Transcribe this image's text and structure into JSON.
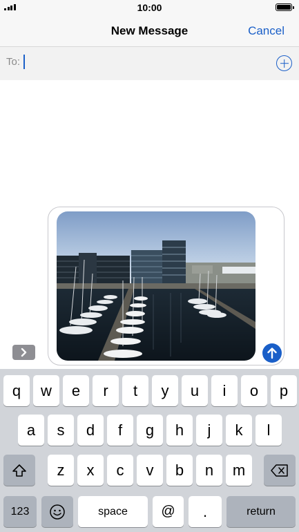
{
  "status_bar": {
    "time": "10:00"
  },
  "nav": {
    "title": "New Message",
    "cancel_label": "Cancel"
  },
  "to_field": {
    "label": "To:"
  },
  "compose": {
    "attachment": "photo of a harbor marina with sailboats and office buildings"
  },
  "keyboard": {
    "row1": [
      "q",
      "w",
      "e",
      "r",
      "t",
      "y",
      "u",
      "i",
      "o",
      "p"
    ],
    "row2": [
      "a",
      "s",
      "d",
      "f",
      "g",
      "h",
      "j",
      "k",
      "l"
    ],
    "row3": [
      "z",
      "x",
      "c",
      "v",
      "b",
      "n",
      "m"
    ],
    "numbers_label": "123",
    "space_label": "space",
    "at_label": "@",
    "period_label": ".",
    "return_label": "return"
  },
  "colors": {
    "accent": "#1a5fc8",
    "keyboard_bg": "#d1d4d9",
    "key": "#ffffff",
    "key_dark": "#adb3bc"
  },
  "icons": [
    "signal-icon",
    "battery-icon",
    "add-contact-icon",
    "expand-icon",
    "send-icon",
    "shift-icon",
    "delete-icon",
    "emoji-icon"
  ]
}
